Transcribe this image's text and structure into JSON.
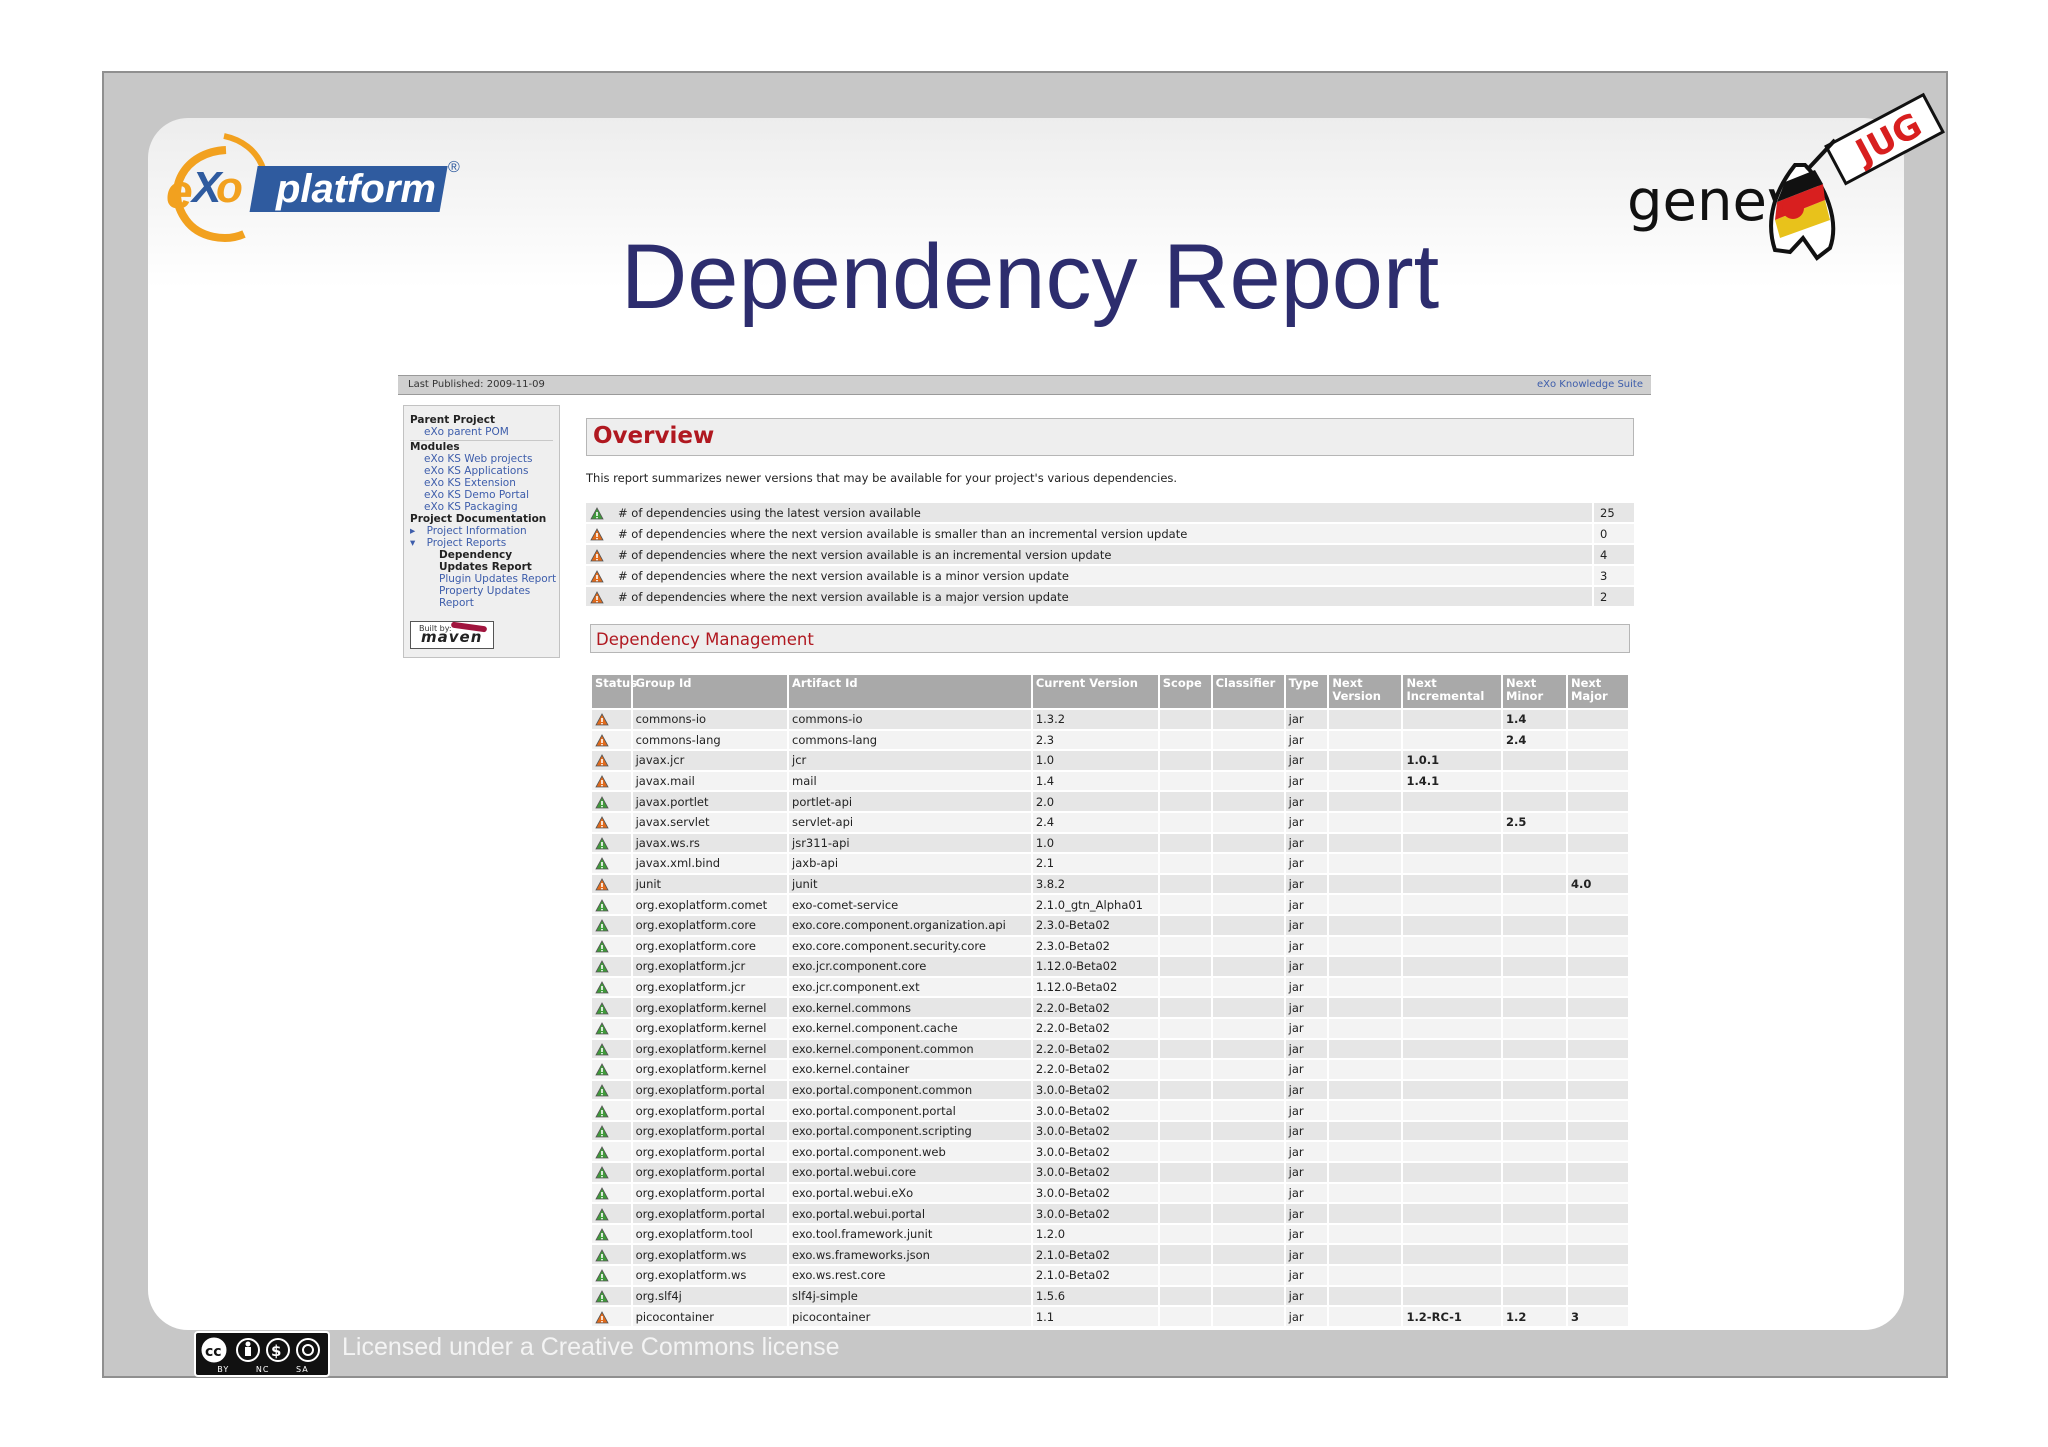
{
  "slide": {
    "title": "Dependency Report",
    "brand_left": "eXo platform",
    "brand_right": "genev",
    "brand_right_tag": "JUG",
    "license": "Licensed under a Creative Commons license",
    "cc_labels": [
      "BY",
      "NC",
      "SA"
    ]
  },
  "report": {
    "last_published": "Last Published: 2009-11-09",
    "suite_link": "eXo Knowledge Suite",
    "sidebar": {
      "parent_heading": "Parent Project",
      "parent_link": "eXo parent POM",
      "modules_heading": "Modules",
      "modules": [
        "eXo KS Web projects",
        "eXo KS Applications",
        "eXo KS Extension",
        "eXo KS Demo Portal",
        "eXo KS Packaging"
      ],
      "docs_heading": "Project Documentation",
      "project_info": "Project Information",
      "project_reports": "Project Reports",
      "current_1": "Dependency",
      "current_2": "Updates Report",
      "plugin_1": "Plugin Updates Report",
      "prop_1": "Property Updates",
      "prop_2": "Report",
      "built_by": "Built by:",
      "maven": "maven"
    },
    "overview_title": "Overview",
    "summary_text": "This report summarizes newer versions that may be available for your project's various dependencies.",
    "summary_rows": [
      {
        "status": "ok",
        "label": "# of dependencies using the latest version available",
        "count": "25"
      },
      {
        "status": "warn",
        "label": "# of dependencies where the next version available is smaller than an incremental version update",
        "count": "0"
      },
      {
        "status": "warn",
        "label": "# of dependencies where the next version available is an incremental version update",
        "count": "4"
      },
      {
        "status": "warn",
        "label": "# of dependencies where the next version available is a minor version update",
        "count": "3"
      },
      {
        "status": "warn",
        "label": "# of dependencies where the next version available is a major version update",
        "count": "2"
      }
    ],
    "dm_title": "Dependency Management",
    "columns": [
      "Status",
      "Group Id",
      "Artifact Id",
      "Current Version",
      "Scope",
      "Classifier",
      "Type",
      "Next Version",
      "Next Incremental",
      "Next Minor",
      "Next Major"
    ],
    "rows": [
      {
        "status": "warn",
        "group": "commons-io",
        "artifact": "commons-io",
        "version": "1.3.2",
        "type": "jar",
        "inc": "",
        "minor": "1.4",
        "major": ""
      },
      {
        "status": "warn",
        "group": "commons-lang",
        "artifact": "commons-lang",
        "version": "2.3",
        "type": "jar",
        "inc": "",
        "minor": "2.4",
        "major": ""
      },
      {
        "status": "warn",
        "group": "javax.jcr",
        "artifact": "jcr",
        "version": "1.0",
        "type": "jar",
        "inc": "1.0.1",
        "minor": "",
        "major": ""
      },
      {
        "status": "warn",
        "group": "javax.mail",
        "artifact": "mail",
        "version": "1.4",
        "type": "jar",
        "inc": "1.4.1",
        "minor": "",
        "major": ""
      },
      {
        "status": "ok",
        "group": "javax.portlet",
        "artifact": "portlet-api",
        "version": "2.0",
        "type": "jar",
        "inc": "",
        "minor": "",
        "major": ""
      },
      {
        "status": "warn",
        "group": "javax.servlet",
        "artifact": "servlet-api",
        "version": "2.4",
        "type": "jar",
        "inc": "",
        "minor": "2.5",
        "major": ""
      },
      {
        "status": "ok",
        "group": "javax.ws.rs",
        "artifact": "jsr311-api",
        "version": "1.0",
        "type": "jar",
        "inc": "",
        "minor": "",
        "major": ""
      },
      {
        "status": "ok",
        "group": "javax.xml.bind",
        "artifact": "jaxb-api",
        "version": "2.1",
        "type": "jar",
        "inc": "",
        "minor": "",
        "major": ""
      },
      {
        "status": "warn",
        "group": "junit",
        "artifact": "junit",
        "version": "3.8.2",
        "type": "jar",
        "inc": "",
        "minor": "",
        "major": "4.0"
      },
      {
        "status": "ok",
        "group": "org.exoplatform.comet",
        "artifact": "exo-comet-service",
        "version": "2.1.0_gtn_Alpha01",
        "type": "jar",
        "inc": "",
        "minor": "",
        "major": ""
      },
      {
        "status": "ok",
        "group": "org.exoplatform.core",
        "artifact": "exo.core.component.organization.api",
        "version": "2.3.0-Beta02",
        "type": "jar",
        "inc": "",
        "minor": "",
        "major": ""
      },
      {
        "status": "ok",
        "group": "org.exoplatform.core",
        "artifact": "exo.core.component.security.core",
        "version": "2.3.0-Beta02",
        "type": "jar",
        "inc": "",
        "minor": "",
        "major": ""
      },
      {
        "status": "ok",
        "group": "org.exoplatform.jcr",
        "artifact": "exo.jcr.component.core",
        "version": "1.12.0-Beta02",
        "type": "jar",
        "inc": "",
        "minor": "",
        "major": ""
      },
      {
        "status": "ok",
        "group": "org.exoplatform.jcr",
        "artifact": "exo.jcr.component.ext",
        "version": "1.12.0-Beta02",
        "type": "jar",
        "inc": "",
        "minor": "",
        "major": ""
      },
      {
        "status": "ok",
        "group": "org.exoplatform.kernel",
        "artifact": "exo.kernel.commons",
        "version": "2.2.0-Beta02",
        "type": "jar",
        "inc": "",
        "minor": "",
        "major": ""
      },
      {
        "status": "ok",
        "group": "org.exoplatform.kernel",
        "artifact": "exo.kernel.component.cache",
        "version": "2.2.0-Beta02",
        "type": "jar",
        "inc": "",
        "minor": "",
        "major": ""
      },
      {
        "status": "ok",
        "group": "org.exoplatform.kernel",
        "artifact": "exo.kernel.component.common",
        "version": "2.2.0-Beta02",
        "type": "jar",
        "inc": "",
        "minor": "",
        "major": ""
      },
      {
        "status": "ok",
        "group": "org.exoplatform.kernel",
        "artifact": "exo.kernel.container",
        "version": "2.2.0-Beta02",
        "type": "jar",
        "inc": "",
        "minor": "",
        "major": ""
      },
      {
        "status": "ok",
        "group": "org.exoplatform.portal",
        "artifact": "exo.portal.component.common",
        "version": "3.0.0-Beta02",
        "type": "jar",
        "inc": "",
        "minor": "",
        "major": ""
      },
      {
        "status": "ok",
        "group": "org.exoplatform.portal",
        "artifact": "exo.portal.component.portal",
        "version": "3.0.0-Beta02",
        "type": "jar",
        "inc": "",
        "minor": "",
        "major": ""
      },
      {
        "status": "ok",
        "group": "org.exoplatform.portal",
        "artifact": "exo.portal.component.scripting",
        "version": "3.0.0-Beta02",
        "type": "jar",
        "inc": "",
        "minor": "",
        "major": ""
      },
      {
        "status": "ok",
        "group": "org.exoplatform.portal",
        "artifact": "exo.portal.component.web",
        "version": "3.0.0-Beta02",
        "type": "jar",
        "inc": "",
        "minor": "",
        "major": ""
      },
      {
        "status": "ok",
        "group": "org.exoplatform.portal",
        "artifact": "exo.portal.webui.core",
        "version": "3.0.0-Beta02",
        "type": "jar",
        "inc": "",
        "minor": "",
        "major": ""
      },
      {
        "status": "ok",
        "group": "org.exoplatform.portal",
        "artifact": "exo.portal.webui.eXo",
        "version": "3.0.0-Beta02",
        "type": "jar",
        "inc": "",
        "minor": "",
        "major": ""
      },
      {
        "status": "ok",
        "group": "org.exoplatform.portal",
        "artifact": "exo.portal.webui.portal",
        "version": "3.0.0-Beta02",
        "type": "jar",
        "inc": "",
        "minor": "",
        "major": ""
      },
      {
        "status": "ok",
        "group": "org.exoplatform.tool",
        "artifact": "exo.tool.framework.junit",
        "version": "1.2.0",
        "type": "jar",
        "inc": "",
        "minor": "",
        "major": ""
      },
      {
        "status": "ok",
        "group": "org.exoplatform.ws",
        "artifact": "exo.ws.frameworks.json",
        "version": "2.1.0-Beta02",
        "type": "jar",
        "inc": "",
        "minor": "",
        "major": ""
      },
      {
        "status": "ok",
        "group": "org.exoplatform.ws",
        "artifact": "exo.ws.rest.core",
        "version": "2.1.0-Beta02",
        "type": "jar",
        "inc": "",
        "minor": "",
        "major": ""
      },
      {
        "status": "ok",
        "group": "org.slf4j",
        "artifact": "slf4j-simple",
        "version": "1.5.6",
        "type": "jar",
        "inc": "",
        "minor": "",
        "major": ""
      },
      {
        "status": "warn",
        "group": "picocontainer",
        "artifact": "picocontainer",
        "version": "1.1",
        "type": "jar",
        "inc": "1.2-RC-1",
        "minor": "1.2",
        "major": "3"
      }
    ]
  },
  "colors": {
    "title": "#2d2d6e",
    "section_heading": "#b01820",
    "link": "#3d5dab",
    "warn_icon": "#e06a1c",
    "ok_icon": "#3f9a3a"
  }
}
